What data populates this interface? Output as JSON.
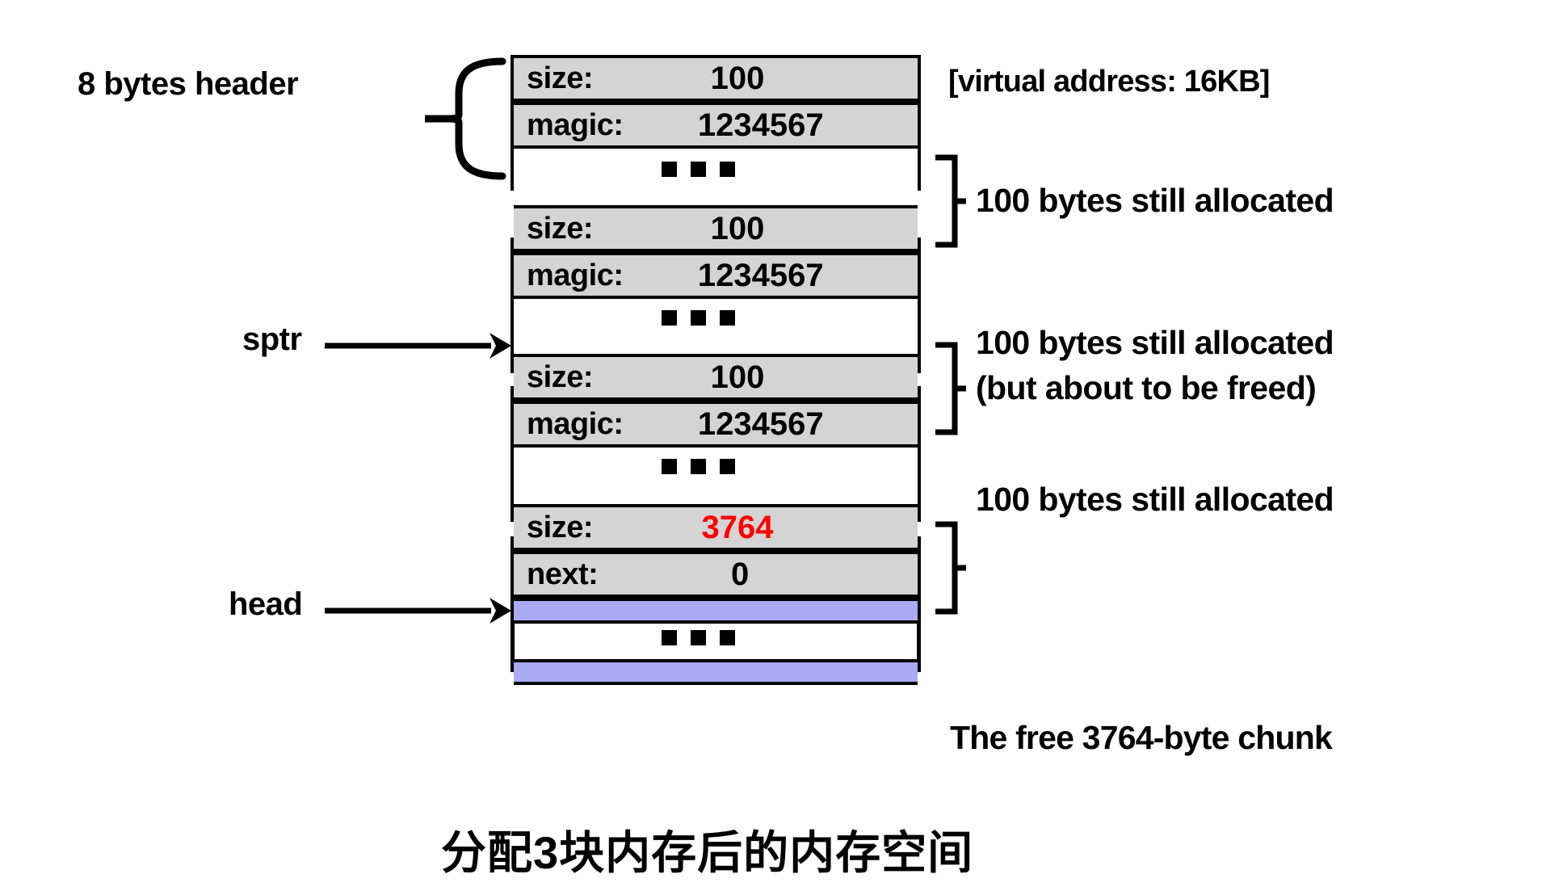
{
  "diagram": {
    "caption": "分配3块内存后的内存空间",
    "virtual_address_note": "[virtual address: 16KB]",
    "header_brace_label": "8 bytes header",
    "free_chunk_note": "The free 3764-byte chunk",
    "colors": {
      "header_fill": "#d4d4d4",
      "free_chunk_fill": "#aaaaf5",
      "highlight_value": "#ff0000",
      "stroke": "#000000",
      "background": "#ffffff"
    },
    "pointers": [
      {
        "name": "sptr",
        "label": "sptr"
      },
      {
        "name": "head",
        "label": "head"
      }
    ],
    "ellipsis": "...",
    "blocks": [
      {
        "id": "block-1",
        "kind": "allocated",
        "rows": [
          {
            "key": "size:",
            "value": "100"
          },
          {
            "key": "magic:",
            "value": "1234567"
          }
        ],
        "annotation": "100 bytes still allocated"
      },
      {
        "id": "block-2",
        "kind": "allocated",
        "rows": [
          {
            "key": "size:",
            "value": "100"
          },
          {
            "key": "magic:",
            "value": "1234567"
          }
        ],
        "annotation_line1": "100 bytes still allocated",
        "annotation_line2": "(but about to be freed)"
      },
      {
        "id": "block-3",
        "kind": "allocated",
        "rows": [
          {
            "key": "size:",
            "value": "100"
          },
          {
            "key": "magic:",
            "value": "1234567"
          }
        ],
        "annotation": "100 bytes still allocated"
      },
      {
        "id": "block-4",
        "kind": "free",
        "rows": [
          {
            "key": "size:",
            "value": "3764",
            "highlight": true
          },
          {
            "key": "next:",
            "value": "0"
          }
        ],
        "annotation": "The free 3764-byte chunk"
      }
    ]
  }
}
